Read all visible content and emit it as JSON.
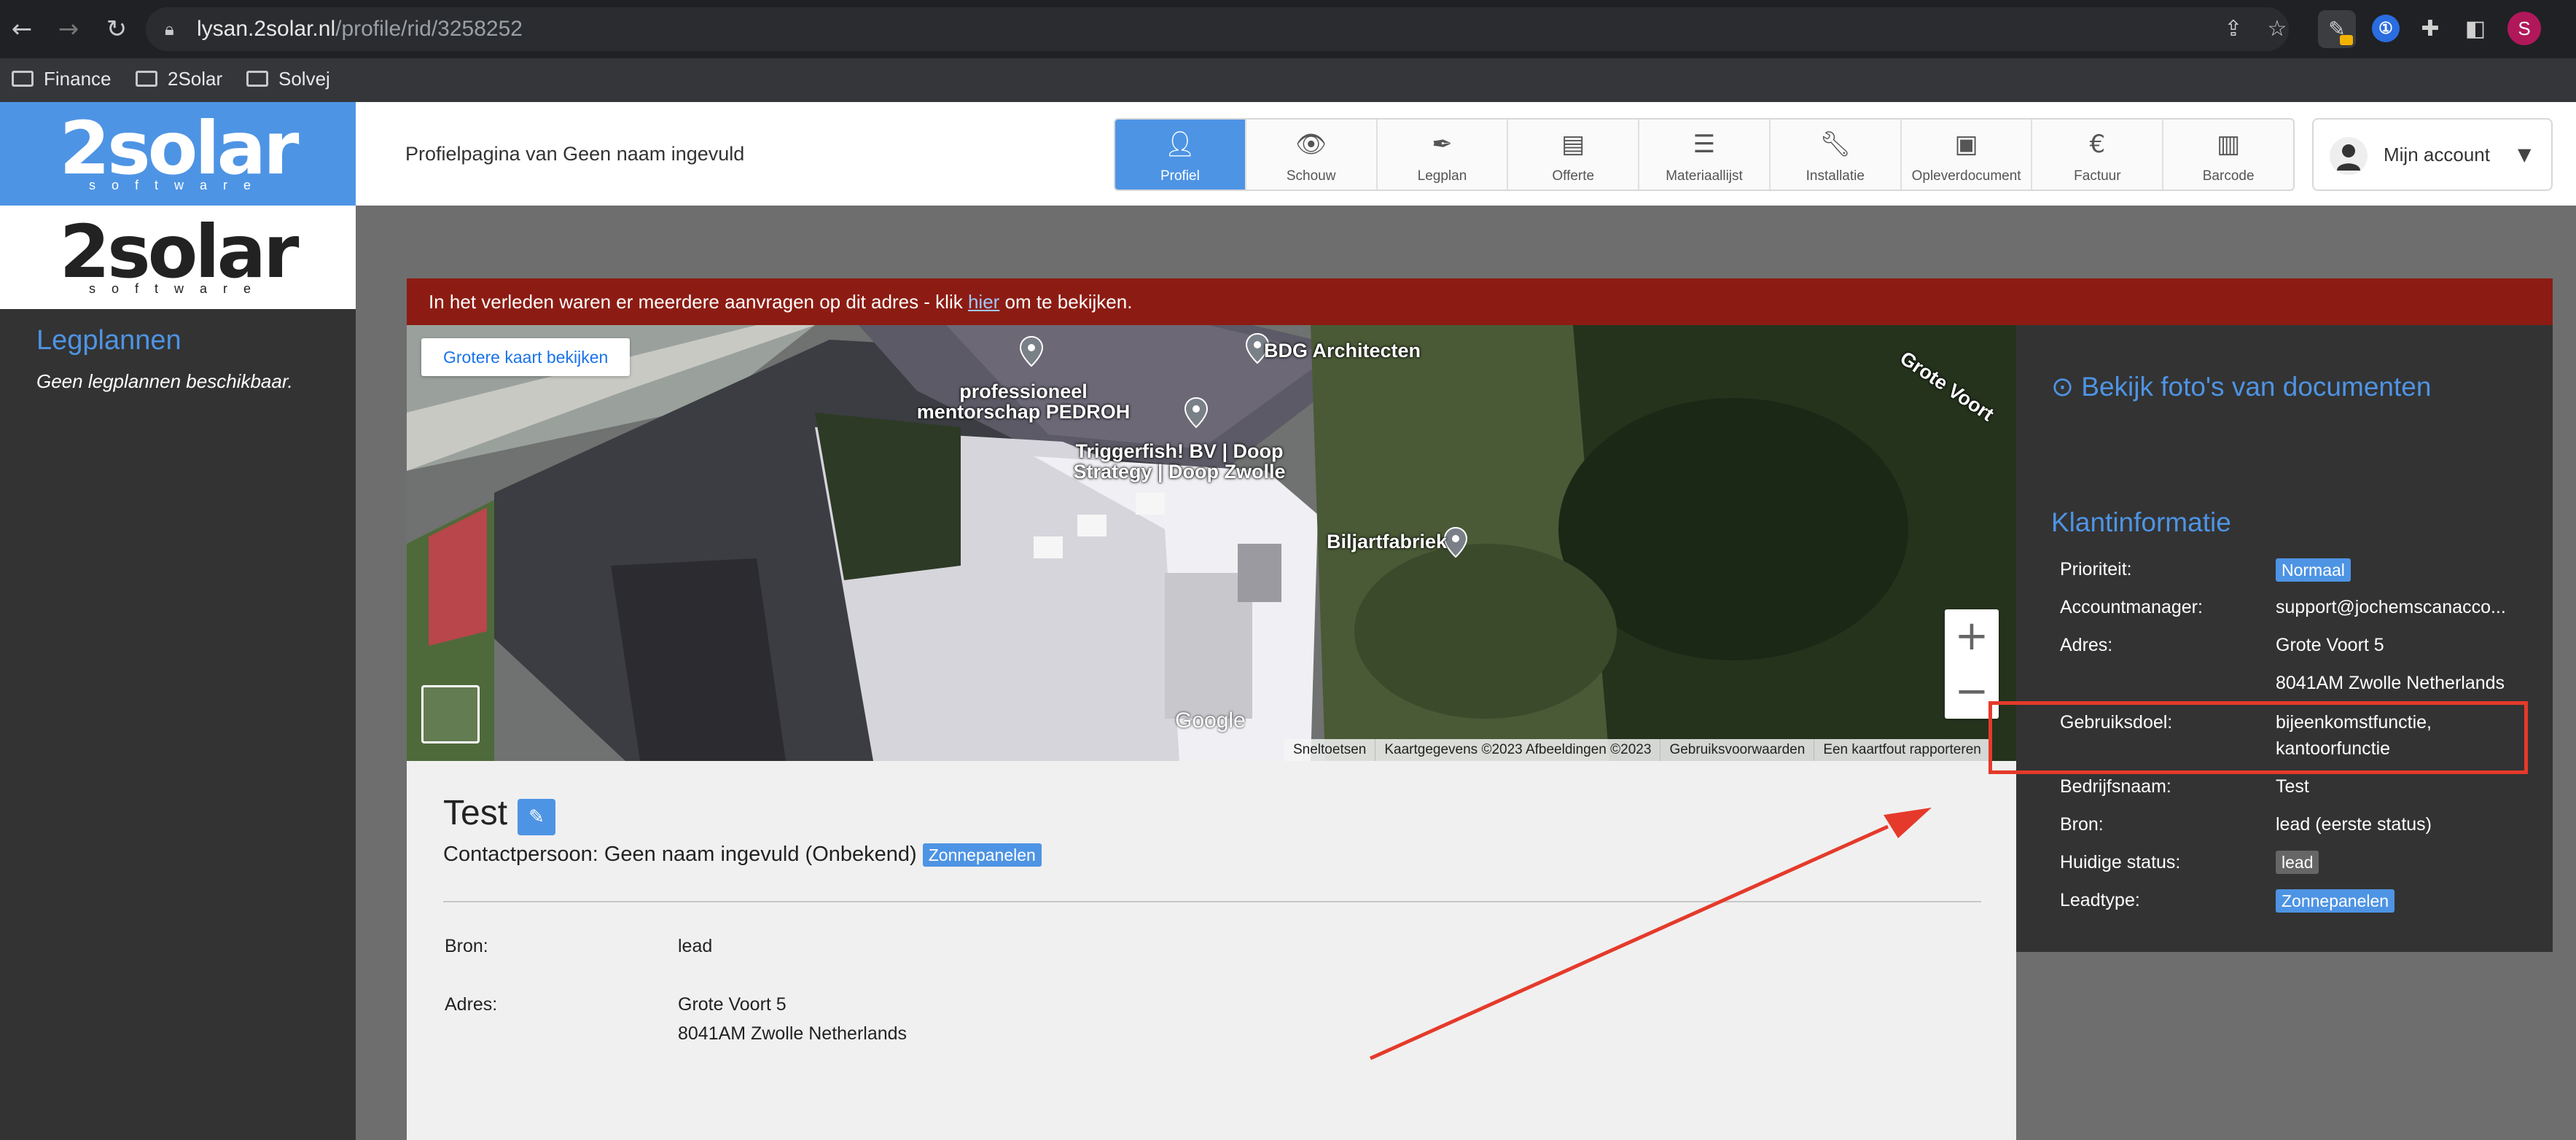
{
  "browser": {
    "url_domain": "lysan.2solar.nl",
    "url_path": "/profile/rid/3258252",
    "bookmarks": [
      "Finance",
      "2Solar",
      "Solvej"
    ],
    "profile_initial": "S"
  },
  "app": {
    "logo_main": "2solar",
    "logo_sub": "software",
    "page_heading": "Profielpagina van Geen naam ingevuld",
    "tabs": [
      {
        "label": "Profiel",
        "icon": "person-icon",
        "active": true
      },
      {
        "label": "Schouw",
        "icon": "eye-icon"
      },
      {
        "label": "Legplan",
        "icon": "feather-icon"
      },
      {
        "label": "Offerte",
        "icon": "document-icon"
      },
      {
        "label": "Materiaallijst",
        "icon": "list-icon"
      },
      {
        "label": "Installatie",
        "icon": "wrench-icon"
      },
      {
        "label": "Opleverdocument",
        "icon": "contact-book-icon"
      },
      {
        "label": "Factuur",
        "icon": "euro-icon"
      },
      {
        "label": "Barcode",
        "icon": "barcode-icon"
      }
    ],
    "account_label": "Mijn account"
  },
  "sidebar": {
    "title": "Legplannen",
    "empty_text": "Geen legplannen beschikbaar."
  },
  "alert": {
    "prefix": "In het verleden waren er meerdere aanvragen op dit adres - klik ",
    "link": "hier",
    "suffix": " om te bekijken."
  },
  "map": {
    "button": "Grotere kaart bekijken",
    "places": {
      "bdg": "BDG Architecten",
      "mentor_1": "professioneel",
      "mentor_2": "mentorschap PEDROH",
      "trigger_1": "Triggerfish! BV | Doop",
      "trigger_2": "Strategy | Doop Zwolle",
      "biljart": "Biljartfabriek",
      "street": "Grote Voort"
    },
    "google": "Google",
    "footer": [
      "Sneltoetsen",
      "Kaartgegevens ©2023 Afbeeldingen ©2023",
      "Gebruiksvoorwaarden",
      "Een kaartfout rapporteren"
    ]
  },
  "customer": {
    "name": "Test",
    "contact_prefix": "Contactpersoon: ",
    "contact_name": "Geen naam ingevuld (Onbekend)",
    "badge": "Zonnepanelen",
    "fields": {
      "bron_label": "Bron:",
      "bron_value": "lead",
      "adres_label": "Adres:",
      "adres_line1": "Grote Voort 5",
      "adres_line2": "8041AM Zwolle Netherlands"
    }
  },
  "right_panel": {
    "photos_link": "Bekijk foto's van documenten",
    "klant_title": "Klantinformatie",
    "rows": {
      "prioriteit_label": "Prioriteit:",
      "prioriteit_value": "Normaal",
      "accountmanager_label": "Accountmanager:",
      "accountmanager_value": "support@jochemscanacco...",
      "adres_label": "Adres:",
      "adres_line1": "Grote Voort 5",
      "adres_line2": "8041AM Zwolle Netherlands",
      "gebruiksdoel_label": "Gebruiksdoel:",
      "gebruiksdoel_line1": "bijeenkomstfunctie,",
      "gebruiksdoel_line2": "kantoorfunctie",
      "bedrijfsnaam_label": "Bedrijfsnaam:",
      "bedrijfsnaam_value": "Test",
      "bron_label": "Bron:",
      "bron_value": "lead (eerste status)",
      "status_label": "Huidige status:",
      "status_value": "lead",
      "leadtype_label": "Leadtype:",
      "leadtype_value": "Zonnepanelen"
    }
  },
  "colors": {
    "brand_blue": "#4e94e4",
    "alert_red": "#8c1c13",
    "annotation_red": "#e53a2b"
  }
}
